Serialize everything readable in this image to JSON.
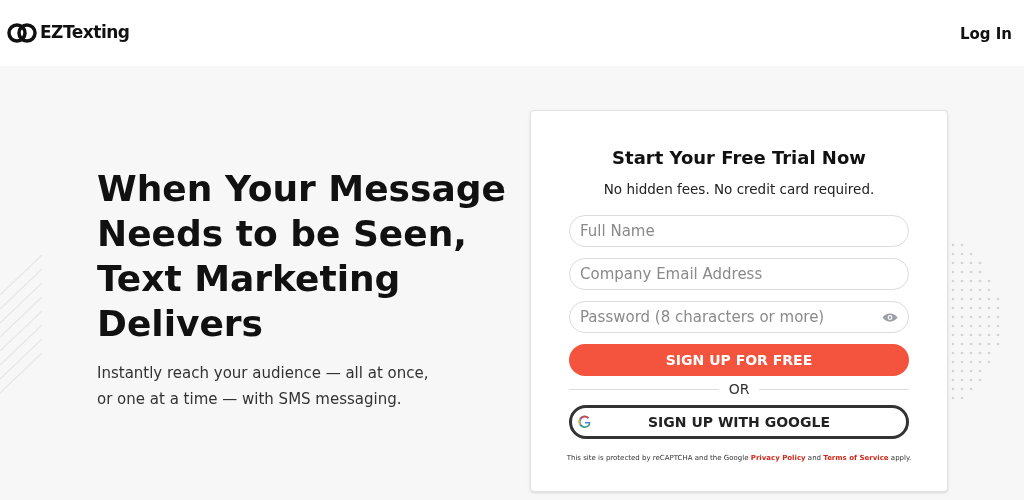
{
  "header": {
    "logo": "EZTexting",
    "login": "Log In"
  },
  "hero": {
    "headline": "When Your Message Needs to be Seen, Text Marketing Delivers",
    "subtext": "Instantly reach your audience — all at once, or one at a time — with SMS messaging."
  },
  "form": {
    "title": "Start Your Free Trial Now",
    "subtitle": "No hidden fees. No credit card required.",
    "fields": [
      {
        "placeholder": "Full Name",
        "kind": "text"
      },
      {
        "placeholder": "Company Email Address",
        "kind": "text"
      },
      {
        "placeholder": "Password (8 characters or more)",
        "kind": "password"
      }
    ],
    "submit": "SIGN UP FOR FREE",
    "divider": "OR",
    "google": "SIGN UP WITH GOOGLE",
    "notice": [
      {
        "kind": "text",
        "text": "This site is protected by reCAPTCHA and the Google"
      },
      {
        "kind": "link",
        "text": "Privacy Policy"
      },
      {
        "kind": "text",
        "text": "and"
      },
      {
        "kind": "link",
        "text": "Terms of Service"
      },
      {
        "kind": "text",
        "text": "apply."
      }
    ]
  }
}
